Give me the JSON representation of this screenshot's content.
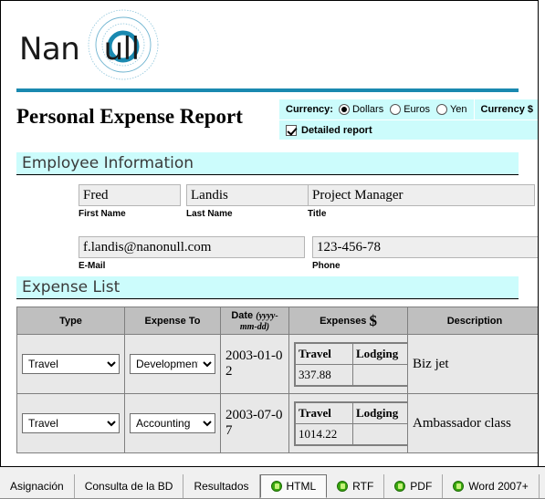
{
  "logo": {
    "text_before": "Nan",
    "text_after": "ull",
    "full_text": "Nanonull",
    "ring_color": "#1a89b0"
  },
  "header": {
    "rule_color": "#1a89b0",
    "title": "Personal Expense Report",
    "currency": {
      "label": "Currency:",
      "options": [
        {
          "label": "Dollars",
          "selected": true
        },
        {
          "label": "Euros",
          "selected": false
        },
        {
          "label": "Yen",
          "selected": false
        }
      ],
      "symbol_label": "Currency $",
      "detailed_report_label": "Detailed report",
      "detailed_report_checked": true,
      "panel_color": "#ccfcfc"
    }
  },
  "employee_section": {
    "heading": "Employee Information",
    "fields": {
      "first_name": {
        "value": "Fred",
        "label": "First Name"
      },
      "last_name": {
        "value": "Landis",
        "label": "Last Name"
      },
      "title": {
        "value": "Project Manager",
        "label": "Title"
      },
      "email": {
        "value": "f.landis@nanonull.com",
        "label": "E-Mail"
      },
      "phone": {
        "value": "123-456-78",
        "label": "Phone"
      }
    }
  },
  "expense_section": {
    "heading": "Expense List",
    "columns": {
      "type": "Type",
      "expense_to": "Expense To",
      "date": "Date",
      "date_format": "(yyyy-mm-dd)",
      "expenses": "Expenses",
      "expenses_symbol": "$",
      "description": "Description"
    },
    "sub_columns": {
      "travel": "Travel",
      "lodging": "Lodging"
    },
    "rows": [
      {
        "type": "Travel",
        "expense_to": "Development",
        "date": "2003-01-02",
        "travel": "337.88",
        "lodging": "",
        "description": "Biz jet"
      },
      {
        "type": "Travel",
        "expense_to": "Accounting",
        "date": "2003-07-07",
        "travel": "1014.22",
        "lodging": "",
        "description": "Ambassador class"
      }
    ]
  },
  "tabs": [
    {
      "label": "Asignación",
      "icon": "",
      "active": false
    },
    {
      "label": "Consulta de la BD",
      "icon": "",
      "active": false
    },
    {
      "label": "Resultados",
      "icon": "",
      "active": false
    },
    {
      "label": "HTML",
      "icon": "run-green-icon",
      "active": true
    },
    {
      "label": "RTF",
      "icon": "run-green-icon",
      "active": false
    },
    {
      "label": "PDF",
      "icon": "run-green-icon",
      "active": false
    },
    {
      "label": "Word 2007+",
      "icon": "run-green-icon",
      "active": false
    }
  ]
}
